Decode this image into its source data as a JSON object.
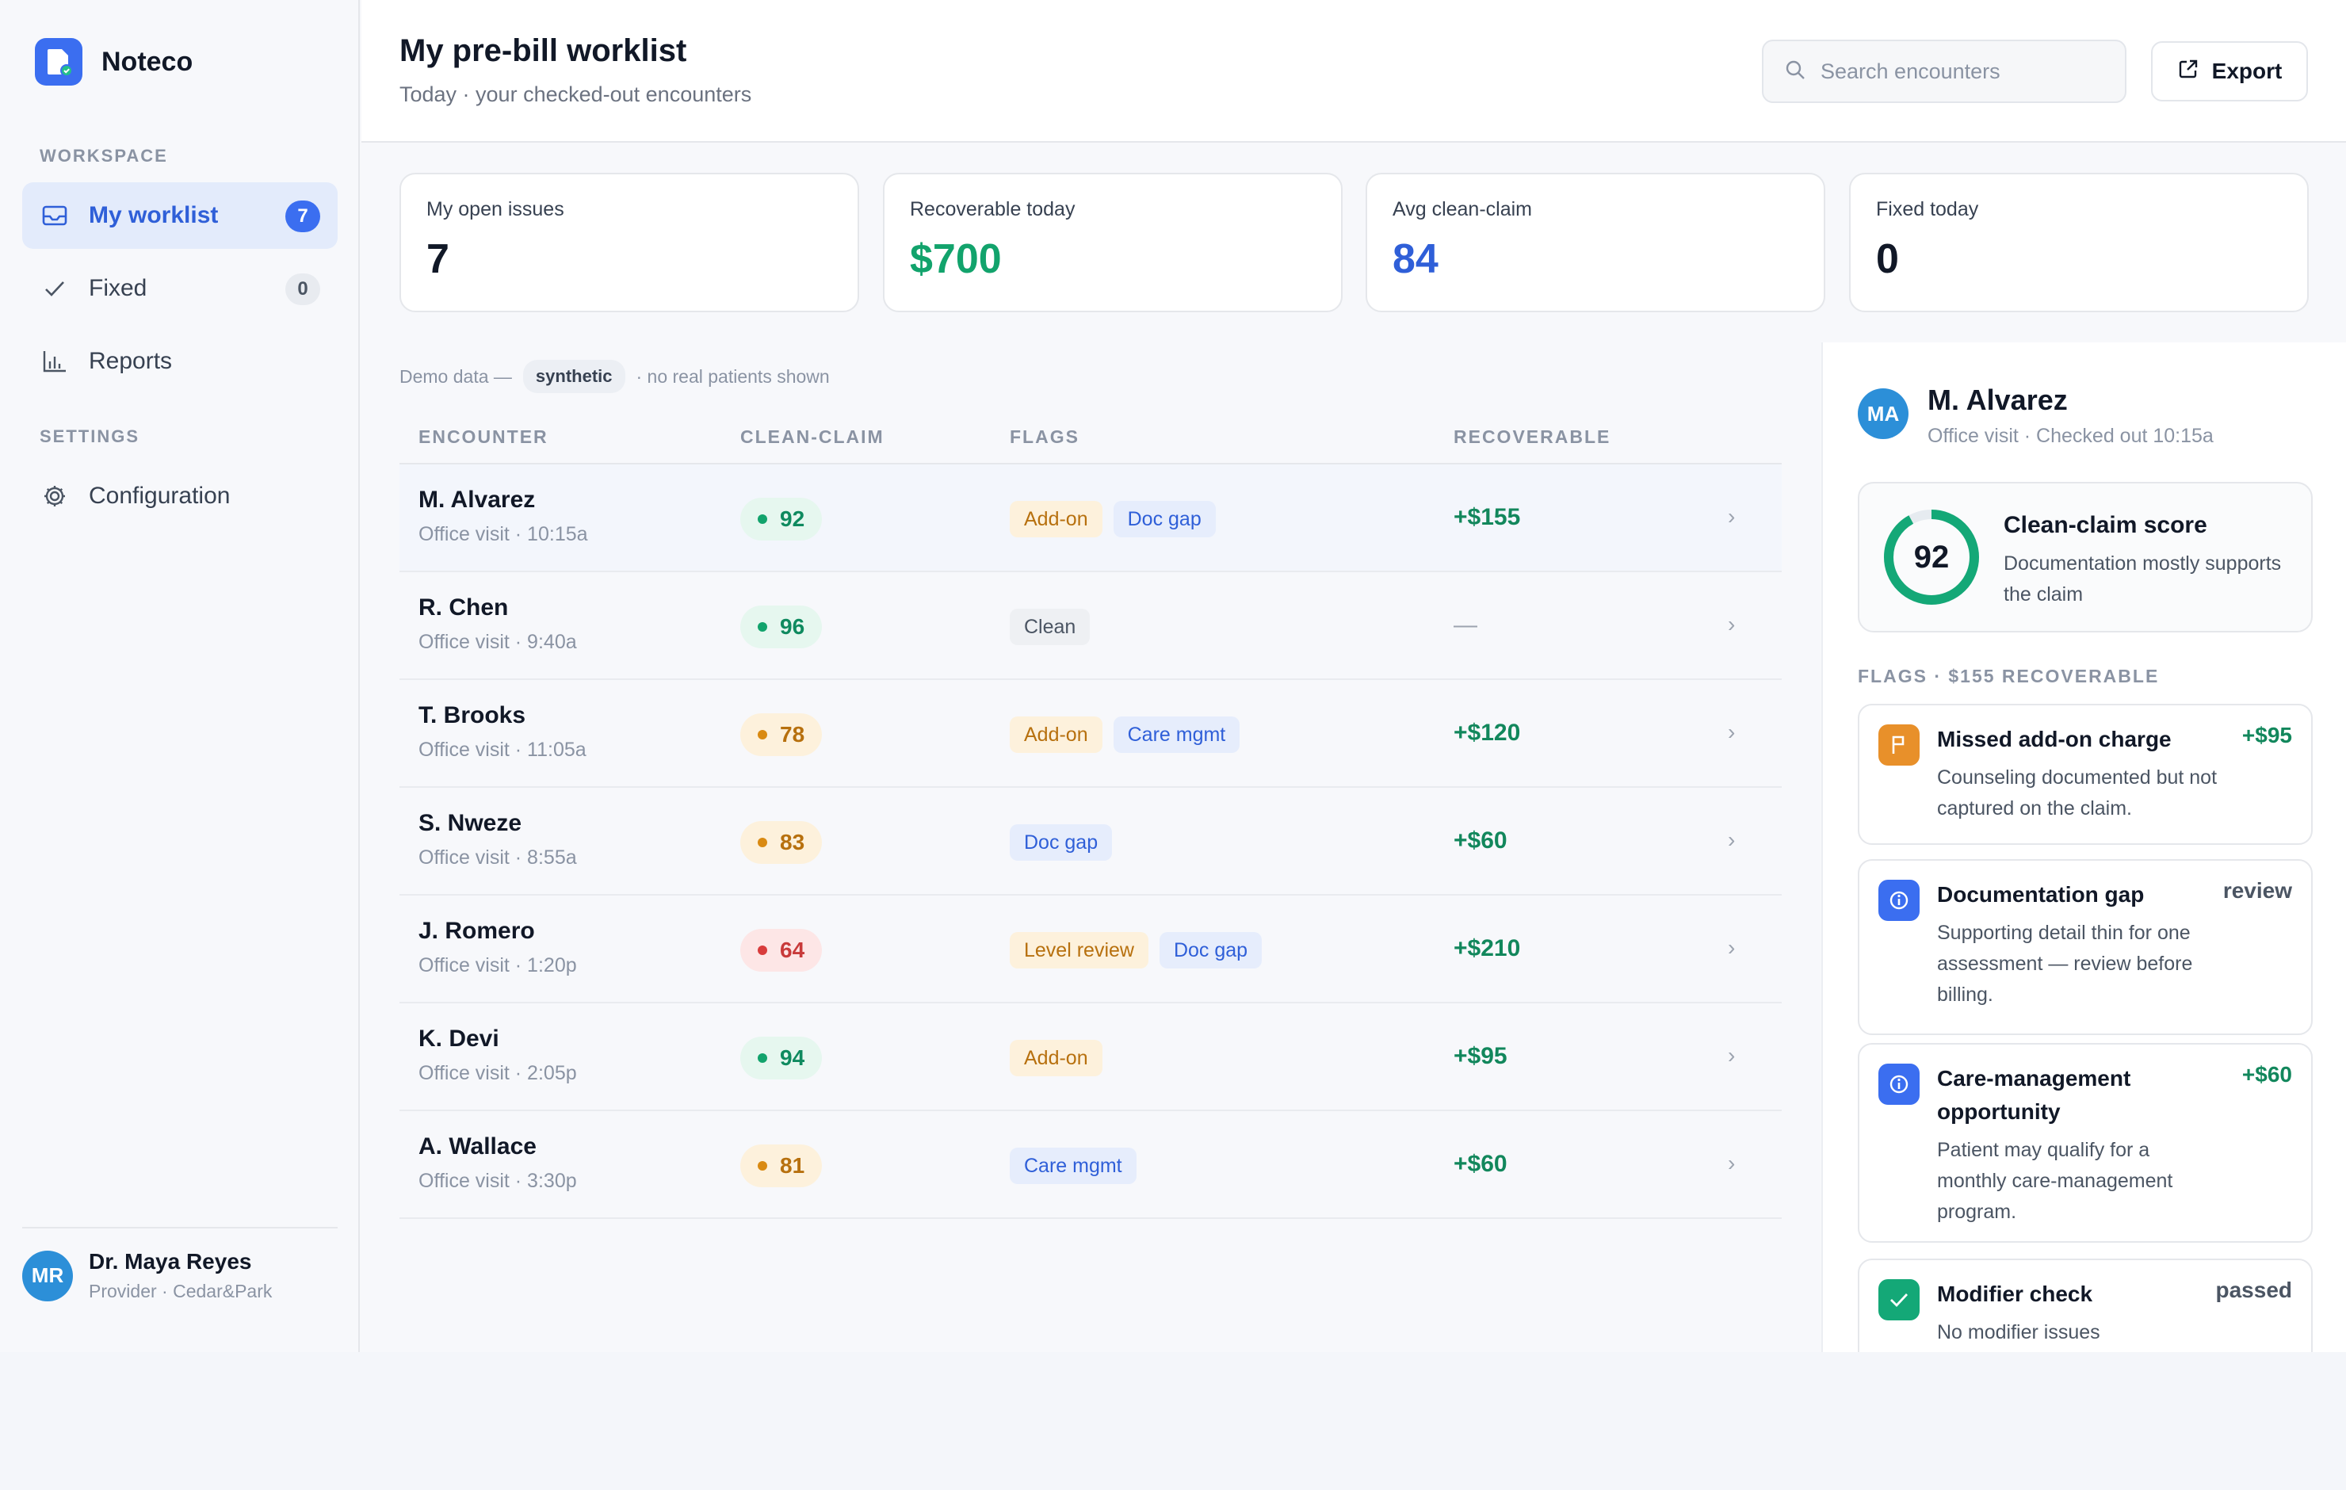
{
  "brand": {
    "name": "Noteco"
  },
  "sidebar": {
    "workspace_label": "WORKSPACE",
    "settings_label": "SETTINGS",
    "items": [
      {
        "label": "My worklist",
        "badge": "7",
        "icon": "inbox-icon"
      },
      {
        "label": "Fixed",
        "badge": "0",
        "icon": "check-icon"
      },
      {
        "label": "Reports",
        "icon": "bar-chart-icon"
      }
    ],
    "settings_items": [
      {
        "label": "Configuration",
        "icon": "gear-icon"
      }
    ],
    "user": {
      "initials": "MR",
      "name": "Dr. Maya Reyes",
      "role": "Provider · Cedar&Park"
    }
  },
  "header": {
    "title": "My pre-bill worklist",
    "subtitle": "Today · your checked-out encounters",
    "search_placeholder": "Search encounters",
    "export_label": "Export"
  },
  "stats": [
    {
      "label": "My open issues",
      "value": "7",
      "color": "#111827"
    },
    {
      "label": "Recoverable today",
      "value": "$700",
      "color": "#12a36c"
    },
    {
      "label": "Avg clean-claim",
      "value": "84",
      "color": "#2f5fd8"
    },
    {
      "label": "Fixed today",
      "value": "0",
      "color": "#111827"
    }
  ],
  "demo_note": {
    "prefix": "Demo data —",
    "pill": "synthetic",
    "suffix": "· no real patients shown"
  },
  "table": {
    "columns": [
      "ENCOUNTER",
      "CLEAN-CLAIM",
      "FLAGS",
      "RECOVERABLE"
    ],
    "rows": [
      {
        "name": "M. Alvarez",
        "sub": "Office visit · 10:15a",
        "score": "92",
        "score_level": "green",
        "flags": [
          [
            "Add-on",
            "amber"
          ],
          [
            "Doc gap",
            "blue"
          ]
        ],
        "recoverable": "+$155",
        "selected": true
      },
      {
        "name": "R. Chen",
        "sub": "Office visit · 9:40a",
        "score": "96",
        "score_level": "green",
        "flags": [
          [
            "Clean",
            "gray"
          ]
        ],
        "recoverable": "—"
      },
      {
        "name": "T. Brooks",
        "sub": "Office visit · 11:05a",
        "score": "78",
        "score_level": "amber",
        "flags": [
          [
            "Add-on",
            "amber"
          ],
          [
            "Care mgmt",
            "blue"
          ]
        ],
        "recoverable": "+$120"
      },
      {
        "name": "S. Nweze",
        "sub": "Office visit · 8:55a",
        "score": "83",
        "score_level": "amber",
        "flags": [
          [
            "Doc gap",
            "blue"
          ]
        ],
        "recoverable": "+$60"
      },
      {
        "name": "J. Romero",
        "sub": "Office visit · 1:20p",
        "score": "64",
        "score_level": "red",
        "flags": [
          [
            "Level review",
            "amber"
          ],
          [
            "Doc gap",
            "blue"
          ]
        ],
        "recoverable": "+$210"
      },
      {
        "name": "K. Devi",
        "sub": "Office visit · 2:05p",
        "score": "94",
        "score_level": "green",
        "flags": [
          [
            "Add-on",
            "amber"
          ]
        ],
        "recoverable": "+$95"
      },
      {
        "name": "A. Wallace",
        "sub": "Office visit · 3:30p",
        "score": "81",
        "score_level": "amber",
        "flags": [
          [
            "Care mgmt",
            "blue"
          ]
        ],
        "recoverable": "+$60"
      }
    ]
  },
  "detail": {
    "initials": "MA",
    "name": "M. Alvarez",
    "sub": "Office visit · Checked out 10:15a",
    "score": "92",
    "score_fraction": 0.92,
    "score_title": "Clean-claim score",
    "score_desc": "Documentation mostly supports the claim",
    "section_label": "FLAGS · $155 RECOVERABLE",
    "flags": [
      {
        "title": "Missed add-on charge",
        "desc": "Counseling documented but not captured on the claim.",
        "tag": "+$95",
        "tag_style": "green",
        "icon": "flag-icon",
        "icon_color": "#e8902a"
      },
      {
        "title": "Documentation gap",
        "desc": "Supporting detail thin for one assessment — review before billing.",
        "tag": "review",
        "tag_style": "gray",
        "icon": "info-icon",
        "icon_color": "#3b6ef0"
      },
      {
        "title": "Care-management opportunity",
        "desc": "Patient may qualify for a monthly care-management program.",
        "tag": "+$60",
        "tag_style": "green",
        "icon": "info-icon",
        "icon_color": "#3b6ef0"
      },
      {
        "title": "Modifier check",
        "desc": "No modifier issues",
        "tag": "passed",
        "tag_style": "gray",
        "icon": "check-icon",
        "icon_color": "#12a36c"
      }
    ]
  }
}
